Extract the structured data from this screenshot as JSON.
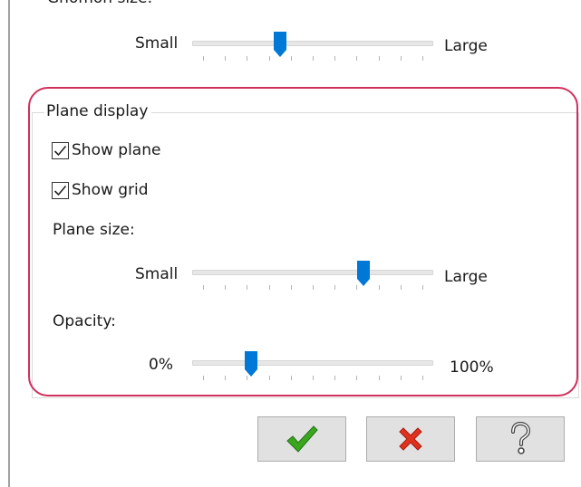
{
  "top": {
    "section_label_partial": "Gnomon size:",
    "min_label": "Small",
    "max_label": "Large",
    "value_fraction": 0.35
  },
  "plane_display": {
    "legend": "Plane display",
    "show_plane": {
      "label": "Show plane",
      "checked": true
    },
    "show_grid": {
      "label": "Show grid",
      "checked": true
    },
    "plane_size": {
      "label": "Plane size:",
      "min_label": "Small",
      "max_label": "Large",
      "value_fraction": 0.73
    },
    "opacity": {
      "label": "Opacity:",
      "min_label": "0%",
      "max_label": "100%",
      "value_fraction": 0.22
    }
  },
  "buttons": {
    "ok_icon": "green-check-icon",
    "cancel_icon": "red-x-icon",
    "help_icon": "question-mark-icon"
  },
  "colors": {
    "highlight": "#d0305c",
    "thumb": "#0078d7",
    "ok_green": "#3aa61e",
    "cancel_red": "#e0301e"
  }
}
